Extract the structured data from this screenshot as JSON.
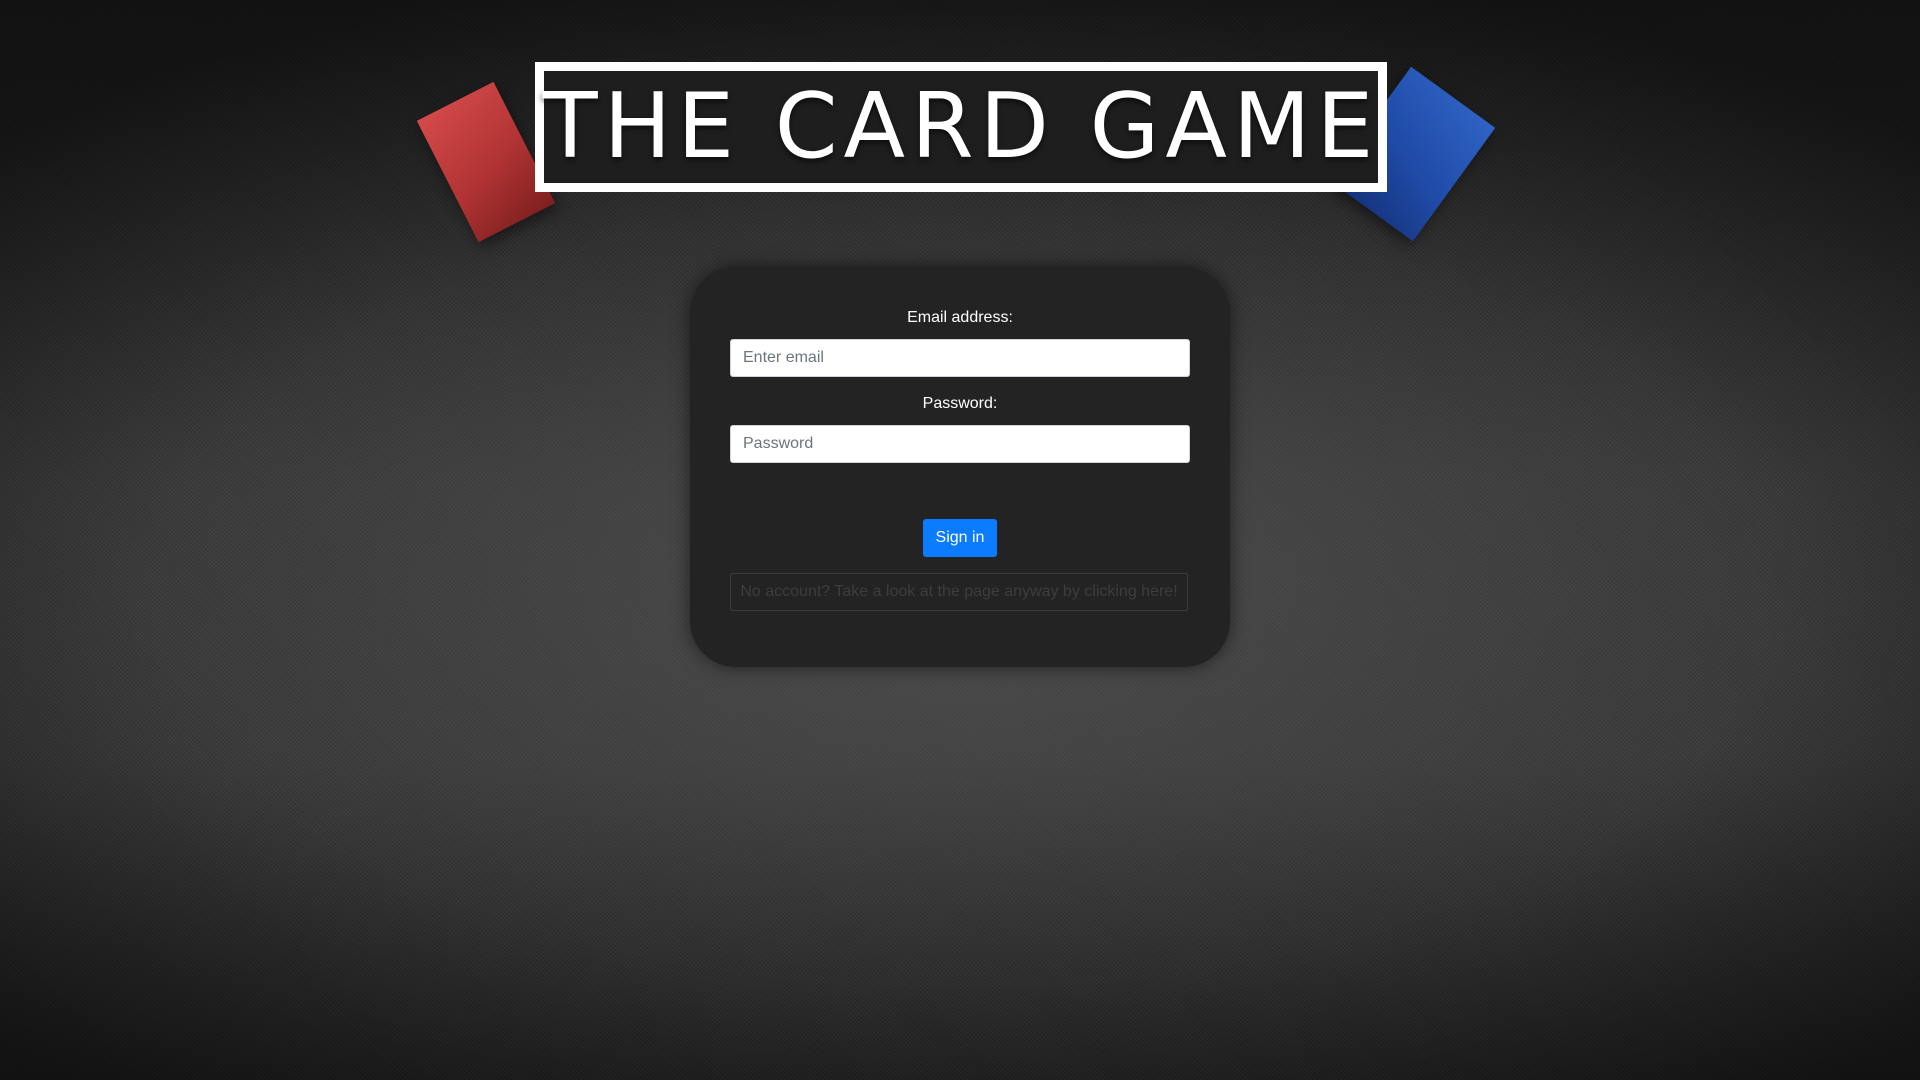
{
  "header": {
    "title": "THE CARD GAME"
  },
  "login": {
    "email_label": "Email address:",
    "email_placeholder": "Enter email",
    "email_value": "",
    "password_label": "Password:",
    "password_placeholder": "Password",
    "password_value": "",
    "signin_label": "Sign in",
    "guest_link_text": "No account? Take a look at the page anyway by clicking here!"
  },
  "colors": {
    "card_red": "#c23b3b",
    "card_blue": "#2555b5",
    "signin_button": "#0b7bff",
    "panel_background": "#232323"
  }
}
